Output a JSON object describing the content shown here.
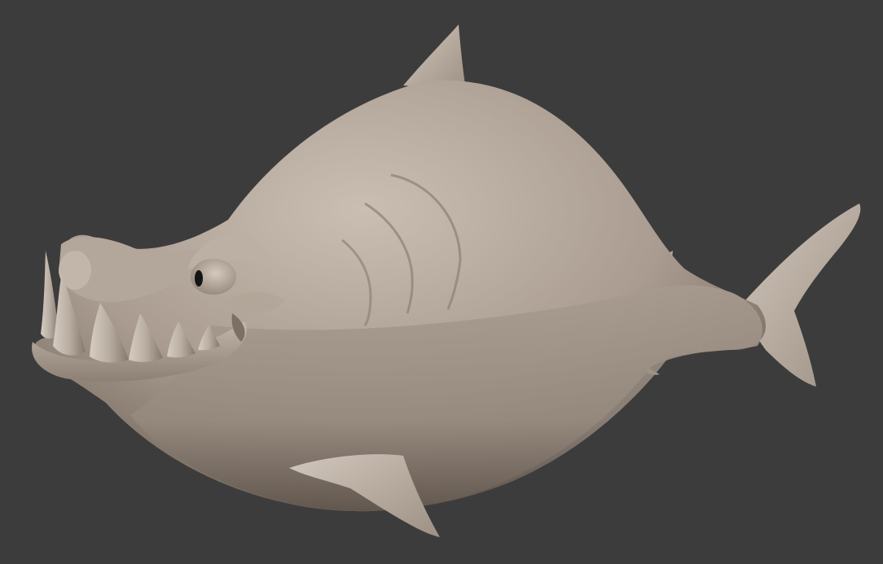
{
  "viewport": {
    "background_color": "#3c3c3c",
    "subject": "shark-sculpt-icon",
    "colors": {
      "clay_light": "#c8bcb0",
      "clay_mid": "#a89a8e",
      "clay_dark": "#6e6157",
      "eye_pupil": "#151515"
    }
  }
}
